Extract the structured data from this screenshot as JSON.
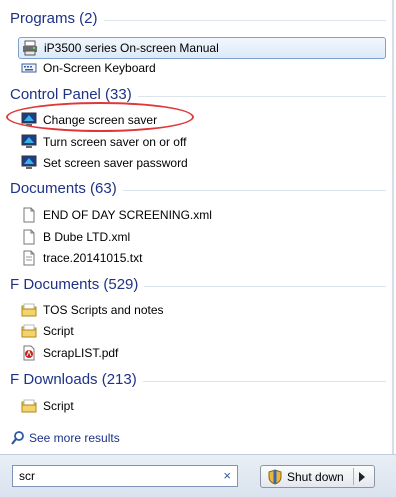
{
  "groups": [
    {
      "header": "Programs (2)",
      "items": [
        {
          "label": "iP3500 series On-screen Manual",
          "icon": "printer-icon"
        },
        {
          "label": "On-Screen Keyboard",
          "icon": "keyboard-icon"
        }
      ]
    },
    {
      "header": "Control Panel (33)",
      "items": [
        {
          "label": "Change screen saver",
          "icon": "monitor-icon"
        },
        {
          "label": "Turn screen saver on or off",
          "icon": "monitor-icon"
        },
        {
          "label": "Set screen saver password",
          "icon": "monitor-icon"
        }
      ]
    },
    {
      "header": "Documents (63)",
      "items": [
        {
          "label": "END OF DAY SCREENING.xml",
          "icon": "document-icon"
        },
        {
          "label": "B Dube LTD.xml",
          "icon": "document-icon"
        },
        {
          "label": "trace.20141015.txt",
          "icon": "document-icon"
        }
      ]
    },
    {
      "header": "F Documents (529)",
      "items": [
        {
          "label": "TOS Scripts and notes",
          "icon": "folder-icon"
        },
        {
          "label": "Script",
          "icon": "folder-icon"
        },
        {
          "label": "ScrapLIST.pdf",
          "icon": "pdf-icon"
        }
      ]
    },
    {
      "header": "F Downloads (213)",
      "items": [
        {
          "label": "Script",
          "icon": "folder-icon"
        }
      ]
    }
  ],
  "see_more": "See more results",
  "search": {
    "value": "scr",
    "clear": "×"
  },
  "shutdown": {
    "label": "Shut down"
  },
  "colors": {
    "header": "#1e3287",
    "highlight": "#e0383a",
    "selected_border": "#7da2ce"
  }
}
